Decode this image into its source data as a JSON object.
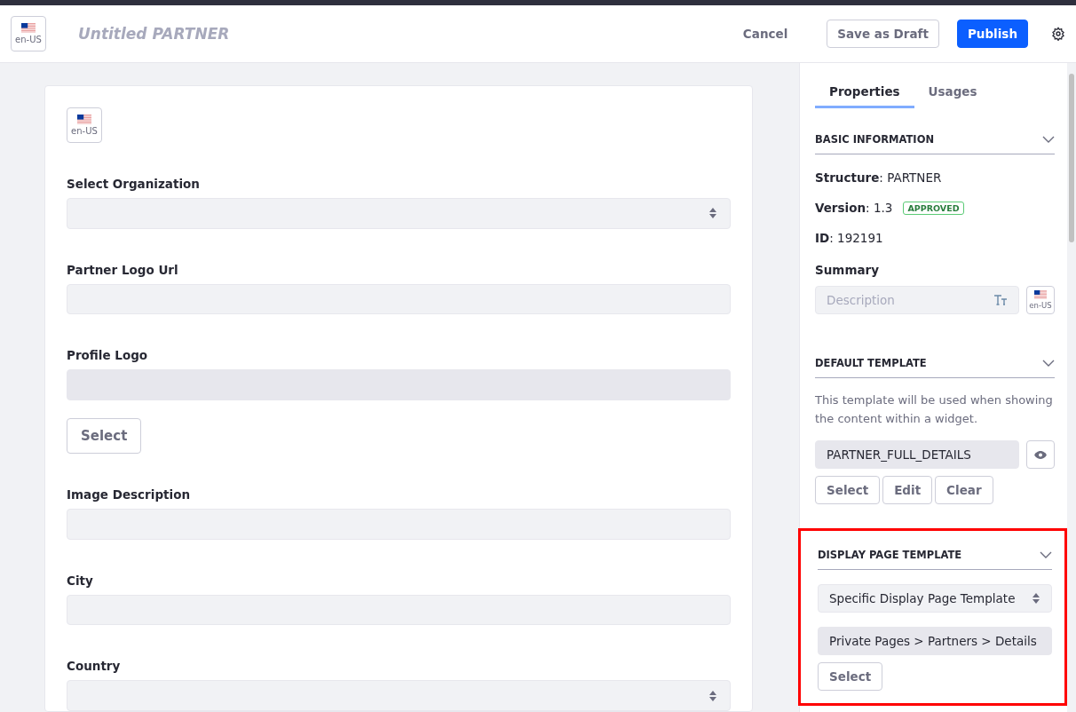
{
  "header": {
    "locale": "en-US",
    "title": "Untitled PARTNER",
    "actions": [
      {
        "label": "Cancel",
        "kind": "link"
      },
      {
        "label": "Save as Draft",
        "kind": "secondary"
      },
      {
        "label": "Publish",
        "kind": "primary"
      }
    ]
  },
  "form": {
    "locale": "en-US",
    "fields": [
      {
        "label": "Select Organization",
        "kind": "select"
      },
      {
        "label": "Partner Logo Url",
        "kind": "text"
      },
      {
        "label": "Profile Logo",
        "kind": "image",
        "button": "Select"
      },
      {
        "label": "Image Description",
        "kind": "text"
      },
      {
        "label": "City",
        "kind": "text"
      },
      {
        "label": "Country",
        "kind": "select"
      }
    ]
  },
  "sidebar": {
    "tabs": [
      {
        "label": "Properties",
        "selected": true
      },
      {
        "label": "Usages",
        "selected": false
      }
    ],
    "basic_information": {
      "title": "BASIC INFORMATION",
      "highlighted": false,
      "properties": [
        {
          "text": "**Structure**: PARTNER"
        },
        {
          "text": "**Version**: 1.3",
          "badge": "APPROVED"
        },
        {
          "text": "**ID**: 192191"
        }
      ],
      "summary_label": "Summary",
      "summary_placeholder": "Description",
      "locale": "en-US"
    },
    "default_template": {
      "title": "DEFAULT TEMPLATE",
      "highlighted": false,
      "description": "This template will be used when showing the content within a widget.",
      "value": "PARTNER_FULL_DETAILS",
      "buttons": [
        "Select",
        "Edit",
        "Clear"
      ]
    },
    "display_page_template": {
      "title": "DISPLAY PAGE TEMPLATE",
      "highlighted": true,
      "select_value": "Specific Display Page Template",
      "value": "Private Pages > Partners > Details",
      "buttons": [
        "Select"
      ]
    }
  }
}
